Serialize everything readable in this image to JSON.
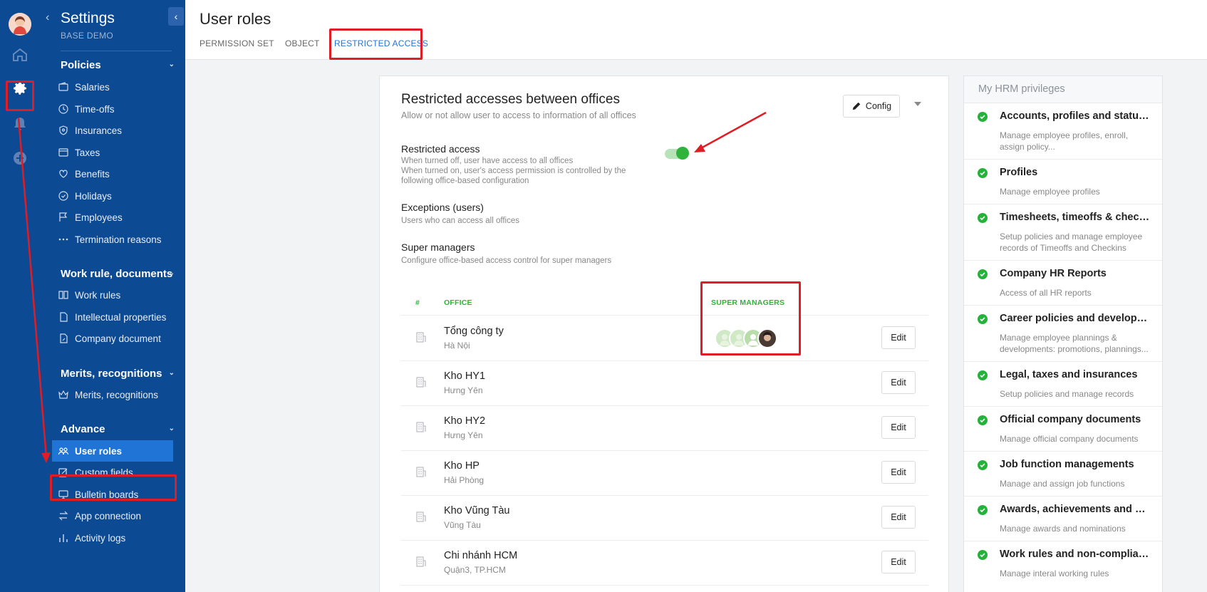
{
  "sidebar": {
    "title": "Settings",
    "subtitle": "BASE DEMO",
    "sections": {
      "policies": "Policies",
      "work_rule": "Work rule, documents",
      "merits": "Merits, recognitions",
      "advance": "Advance"
    },
    "items": {
      "salaries": "Salaries",
      "timeoffs": "Time-offs",
      "insurances": "Insurances",
      "taxes": "Taxes",
      "benefits": "Benefits",
      "holidays": "Holidays",
      "employees": "Employees",
      "termination": "Termination reasons",
      "work_rules": "Work rules",
      "intellectual": "Intellectual properties",
      "company_doc": "Company document",
      "merits_item": "Merits, recognitions",
      "user_roles": "User roles",
      "custom_fields": "Custom fields",
      "bulletin": "Bulletin boards",
      "app_connection": "App connection",
      "activity_logs": "Activity logs"
    }
  },
  "header": {
    "title": "User roles",
    "tabs": {
      "permission_set": "PERMISSION SET",
      "object": "OBJECT",
      "restricted": "RESTRICTED ACCESS"
    }
  },
  "card": {
    "title": "Restricted accesses between offices",
    "subtitle": "Allow or not allow user to access to information of all offices",
    "config_label": "Config",
    "restricted": {
      "label": "Restricted access",
      "desc1": "When turned off, user have access to all offices",
      "desc2": "When turned on, user's access permission is controlled by the",
      "desc3": "following office-based configuration",
      "enabled": true
    },
    "exceptions": {
      "label": "Exceptions (users)",
      "desc": "Users who can access all offices"
    },
    "super": {
      "label": "Super managers",
      "desc": "Configure office-based access control for super managers"
    },
    "table": {
      "col_num": "#",
      "col_office": "OFFICE",
      "col_super": "SUPER MANAGERS",
      "edit_label": "Edit",
      "rows": [
        {
          "name": "Tổng công ty",
          "location": "Hà Nội"
        },
        {
          "name": "Kho HY1",
          "location": "Hưng Yên"
        },
        {
          "name": "Kho HY2",
          "location": "Hưng Yên"
        },
        {
          "name": "Kho HP",
          "location": "Hải Phòng"
        },
        {
          "name": "Kho Vũng Tàu",
          "location": "Vũng Tàu"
        },
        {
          "name": "Chi nhánh HCM",
          "location": "Quận3, TP.HCM"
        }
      ]
    }
  },
  "privileges": {
    "title": "My HRM privileges",
    "items": [
      {
        "title": "Accounts, profiles and status management",
        "desc": "Manage employee profiles, enroll, assign policy..."
      },
      {
        "title": "Profiles",
        "desc": "Manage employee profiles"
      },
      {
        "title": "Timesheets, timeoffs & checkins",
        "desc": "Setup policies and manage employee records of Timeoffs and Checkins"
      },
      {
        "title": "Company HR Reports",
        "desc": "Access of all HR reports"
      },
      {
        "title": "Career policies and developments",
        "desc": "Manage employee plannings & developments: promotions, plannings..."
      },
      {
        "title": "Legal, taxes and insurances",
        "desc": "Setup policies and manage records"
      },
      {
        "title": "Official company documents",
        "desc": "Manage official company documents"
      },
      {
        "title": "Job function managements",
        "desc": "Manage and assign job functions"
      },
      {
        "title": "Awards, achievements and certifications",
        "desc": "Manage awards and nominations"
      },
      {
        "title": "Work rules and non-compliance",
        "desc": "Manage interal working rules"
      }
    ]
  },
  "colors": {
    "sidebar": "#0d4a94",
    "accent": "#1f74d6",
    "green": "#2fb33b",
    "annotation": "#e01c24"
  }
}
